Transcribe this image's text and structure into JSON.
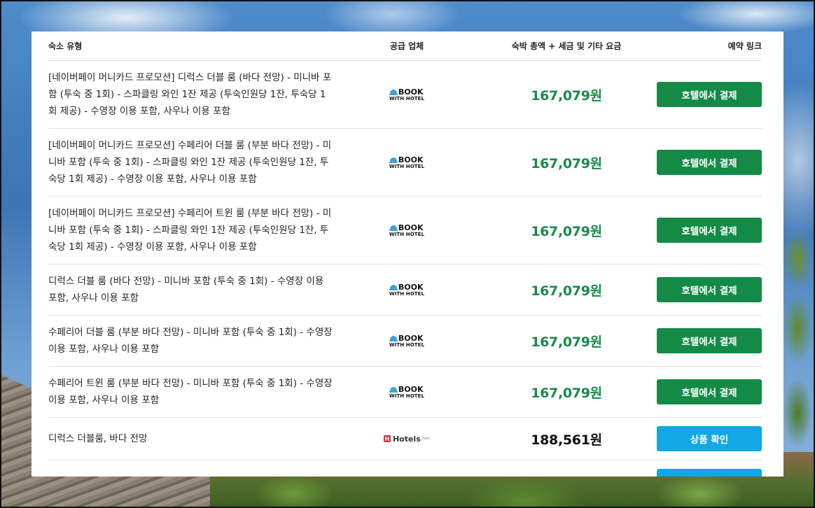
{
  "table": {
    "headers": {
      "room_type": "숙소 유형",
      "provider": "공급 업체",
      "total": "숙박 총액 + 세금 및 기타 요금",
      "booking": "예약 링크"
    },
    "rows": [
      {
        "description": "[네이버페이 머니카드 프로모션] 디럭스 더블 룸 (바다 전망) - 미니바 포함 (투숙 중 1회) - 스파클링 와인 1잔 제공 (투숙인원당 1잔, 투숙당 1회 제공) - 수영장 이용 포함, 사우나 이용 포함",
        "provider_logo": {
          "name": "book-with-hotel-logo",
          "line1": "BOOK",
          "line2": "WITH HOTEL"
        },
        "price": "167,079원",
        "button": "호텔에서 결제"
      },
      {
        "description": "[네이버페이 머니카드 프로모션] 수페리어 더블 룸 (부분 바다 전망) - 미니바 포함 (투숙 중 1회) - 스파클링 와인 1잔 제공 (투숙인원당 1잔, 투숙당 1회 제공) - 수영장 이용 포함, 사우나 이용 포함",
        "provider_logo": {
          "name": "book-with-hotel-logo",
          "line1": "BOOK",
          "line2": "WITH HOTEL"
        },
        "price": "167,079원",
        "button": "호텔에서 결제"
      },
      {
        "description": "[네이버페이 머니카드 프로모션] 수페리어 트윈 룸 (부분 바다 전망) - 미니바 포함 (투숙 중 1회) - 스파클링 와인 1잔 제공 (투숙인원당 1잔, 투숙당 1회 제공) - 수영장 이용 포함, 사우나 이용 포함",
        "provider_logo": {
          "name": "book-with-hotel-logo",
          "line1": "BOOK",
          "line2": "WITH HOTEL"
        },
        "price": "167,079원",
        "button": "호텔에서 결제"
      },
      {
        "description": "디럭스 더블 룸 (바다 전망) - 미니바 포함 (투숙 중 1회) - 수영장 이용 포함, 사우나 이용 포함",
        "provider_logo": {
          "name": "book-with-hotel-logo",
          "line1": "BOOK",
          "line2": "WITH HOTEL"
        },
        "price": "167,079원",
        "button": "호텔에서 결제"
      },
      {
        "description": "수페리어 더블 룸 (부분 바다 전망) - 미니바 포함 (투숙 중 1회) - 수영장 이용 포함, 사우나 이용 포함",
        "provider_logo": {
          "name": "book-with-hotel-logo",
          "line1": "BOOK",
          "line2": "WITH HOTEL"
        },
        "price": "167,079원",
        "button": "호텔에서 결제"
      },
      {
        "description": "수페리어 트윈 룸 (부분 바다 전망) - 미니바 포함 (투숙 중 1회) - 수영장 이용 포함, 사우나 이용 포함",
        "provider_logo": {
          "name": "book-with-hotel-logo",
          "line1": "BOOK",
          "line2": "WITH HOTEL"
        },
        "price": "167,079원",
        "button": "호텔에서 결제"
      },
      {
        "description": "디럭스 더블룸, 바다 전망",
        "provider_logo": {
          "name": "hotels-com-logo",
          "line1": "Hotels",
          "line2": ".com"
        },
        "price": "188,561원",
        "button": "상품 확인"
      }
    ]
  },
  "colors": {
    "price_green": "#188a4a",
    "button_green": "#148a47",
    "button_blue": "#12a7e6"
  }
}
